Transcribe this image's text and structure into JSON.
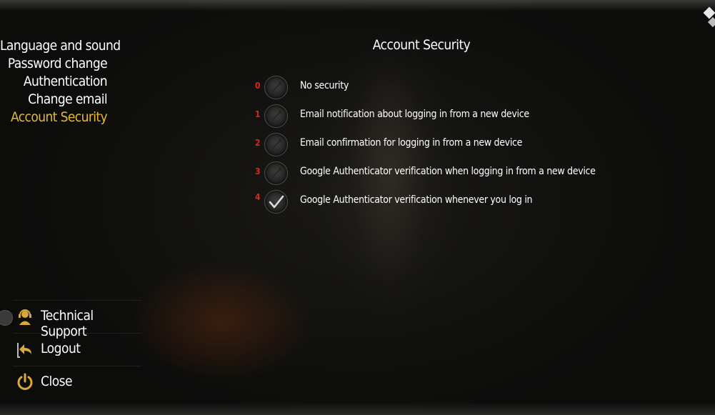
{
  "nav": {
    "items": [
      {
        "label": "Language and sound",
        "active": false
      },
      {
        "label": "Password change",
        "active": false
      },
      {
        "label": "Authentication",
        "active": false
      },
      {
        "label": "Change email",
        "active": false
      },
      {
        "label": "Account Security",
        "active": true
      }
    ]
  },
  "content": {
    "title": "Account Security",
    "options": [
      {
        "num": "0",
        "label": "No security",
        "selected": false
      },
      {
        "num": "1",
        "label": "Email notification about logging in from a new device",
        "selected": false
      },
      {
        "num": "2",
        "label": "Email confirmation for logging in from a new device",
        "selected": false
      },
      {
        "num": "3",
        "label": "Google Authenticator verification when logging in from a new device",
        "selected": false
      },
      {
        "num": "4",
        "label": "Google Authenticator verification whenever you log in",
        "selected": true
      }
    ]
  },
  "bottom_menu": {
    "support": {
      "label": "Technical Support",
      "icon": "headset-icon"
    },
    "logout": {
      "label": "Logout",
      "icon": "logout-arrow-icon"
    },
    "close": {
      "label": "Close",
      "icon": "power-icon"
    }
  },
  "colors": {
    "accent": "#e8b933",
    "option_number": "#d22a1e",
    "text": "#ffffff"
  }
}
